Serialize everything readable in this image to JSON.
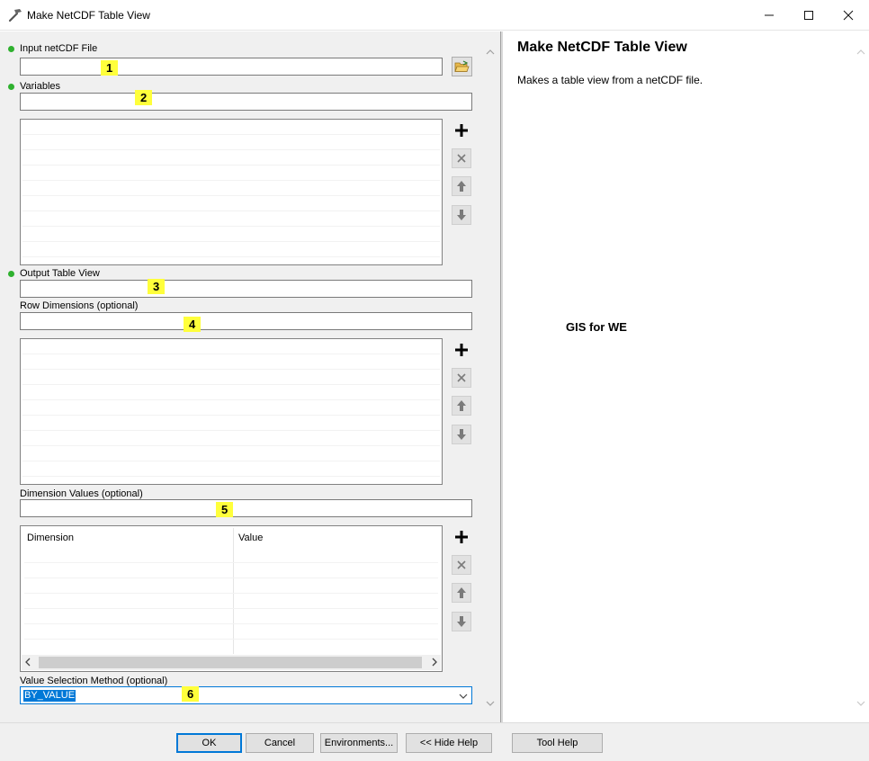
{
  "window": {
    "title": "Make NetCDF Table View",
    "controls": {
      "minimize": "—",
      "maximize": "☐",
      "close": "✕"
    }
  },
  "form": {
    "input_file": {
      "label": "Input netCDF File",
      "value": "",
      "required": true,
      "marker": "1"
    },
    "variables": {
      "label": "Variables",
      "value": "",
      "required": true,
      "marker": "2"
    },
    "output_table": {
      "label": "Output Table View",
      "value": "",
      "required": true,
      "marker": "3"
    },
    "row_dimensions": {
      "label": "Row Dimensions (optional)",
      "value": "",
      "marker": "4"
    },
    "dimension_values": {
      "label": "Dimension Values (optional)",
      "value": "",
      "marker": "5",
      "columns": [
        "Dimension",
        "Value"
      ]
    },
    "value_selection": {
      "label": "Value Selection Method (optional)",
      "value": "BY_VALUE",
      "marker": "6"
    }
  },
  "help": {
    "title": "Make NetCDF Table View",
    "description": "Makes a table view from a netCDF file.",
    "watermark": "GIS for WE"
  },
  "buttons": {
    "ok": "OK",
    "cancel": "Cancel",
    "environments": "Environments...",
    "hide_help": "<< Hide Help",
    "tool_help": "Tool Help"
  },
  "icons": {
    "app": "hammer-icon",
    "browse": "open-folder-icon",
    "add": "plus-icon",
    "remove": "x-icon",
    "up": "arrow-up-icon",
    "down": "arrow-down-icon"
  },
  "colors": {
    "required_dot": "#2fb12f",
    "highlight": "#ffff3b",
    "selection": "#0078d7"
  }
}
